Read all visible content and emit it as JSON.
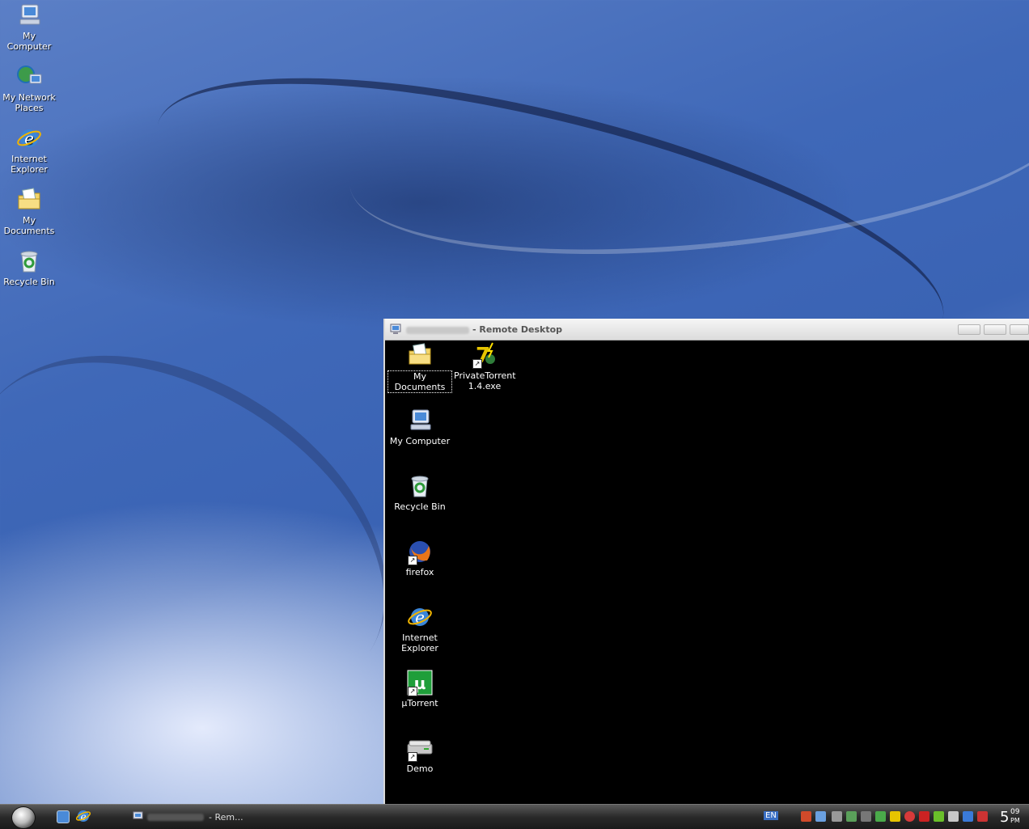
{
  "desktop": {
    "icons": [
      {
        "label": "My Computer",
        "icon": "my-computer-icon"
      },
      {
        "label": "My Network Places",
        "icon": "network-places-icon"
      },
      {
        "label": "Internet Explorer",
        "icon": "internet-explorer-icon"
      },
      {
        "label": "My Documents",
        "icon": "my-documents-icon"
      },
      {
        "label": "Recycle Bin",
        "icon": "recycle-bin-icon"
      }
    ]
  },
  "remote_window": {
    "title": "- Remote Desktop",
    "icons": [
      {
        "label": "My Documents",
        "icon": "my-documents-icon",
        "selected": true
      },
      {
        "label": "PrivateTorrent 1.4.exe",
        "icon": "privatetorrent-icon"
      },
      {
        "label": "My Computer",
        "icon": "my-computer-icon"
      },
      {
        "label": "Recycle Bin",
        "icon": "recycle-bin-icon"
      },
      {
        "label": "firefox",
        "icon": "firefox-icon"
      },
      {
        "label": "Internet Explorer",
        "icon": "internet-explorer-icon"
      },
      {
        "label": "µTorrent",
        "icon": "utorrent-icon"
      },
      {
        "label": "Demo",
        "icon": "drive-icon"
      }
    ]
  },
  "taskbar": {
    "task_label": "- Rem...",
    "language": "EN",
    "clock_hour": "5",
    "clock_minute": "09",
    "clock_ampm": "PM"
  },
  "colors": {
    "accent": "#3a63b4",
    "remote_bg": "#000000",
    "taskbar": "#2a2a2a"
  }
}
